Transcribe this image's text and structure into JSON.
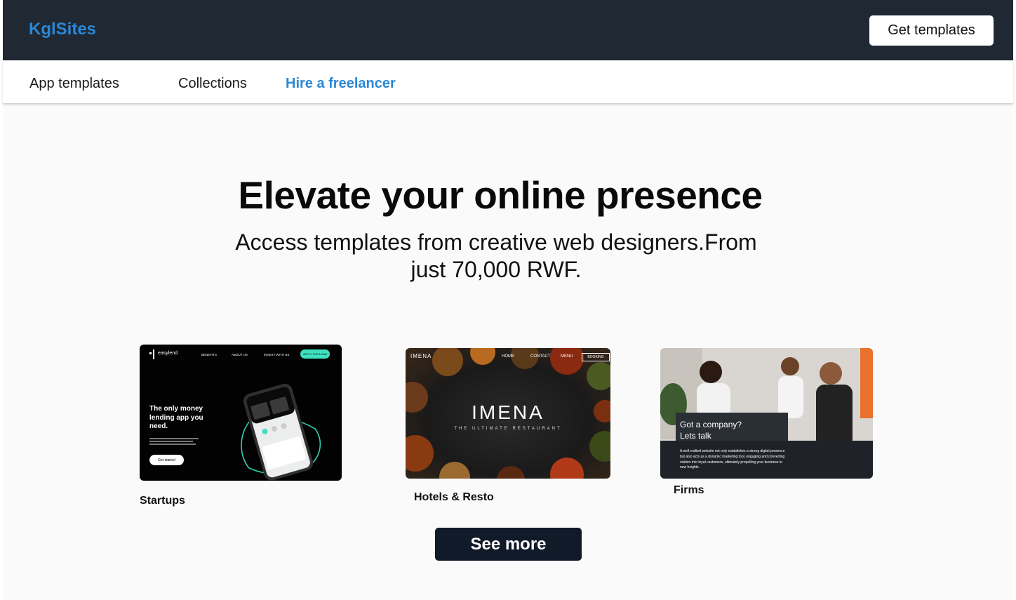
{
  "header": {
    "logo": "KglSites",
    "cta_label": "Get templates"
  },
  "nav": {
    "items": [
      {
        "label": "App templates"
      },
      {
        "label": "Collections"
      },
      {
        "label": "Hire a freelancer"
      }
    ]
  },
  "hero": {
    "title": "Elevate your online presence",
    "subtitle": "Access templates from creative web designers.From just 70,000 RWF."
  },
  "templates": [
    {
      "label": "Startups",
      "preview": {
        "brand": "easylend",
        "nav": [
          "BENEFITS",
          "ABOUT US",
          "INVEST WITH US"
        ],
        "cta": "APPLY FOR LOAN",
        "headline": "The only money lending app you need.",
        "button": "Get started"
      }
    },
    {
      "label": "Hotels & Resto",
      "preview": {
        "brand": "IMENA",
        "nav": [
          "HOME",
          "CONTACT",
          "MENU"
        ],
        "cta": "BOOKING",
        "headline": "IMENA",
        "tagline": "THE ULTIMATE RESTAURANT"
      }
    },
    {
      "label": "Firms",
      "preview": {
        "headline": "Got a company? Lets talk",
        "body": "A well-crafted website not only establishes a strong digital presence but also acts as a dynamic marketing tool, engaging and converting visitors into loyal customers, ultimately propelling your business to new heights."
      }
    }
  ],
  "see_more_label": "See more",
  "colors": {
    "topbar": "#1f2833",
    "accent": "#2b87d6",
    "button_dark": "#111a29",
    "background": "#fafafa"
  }
}
